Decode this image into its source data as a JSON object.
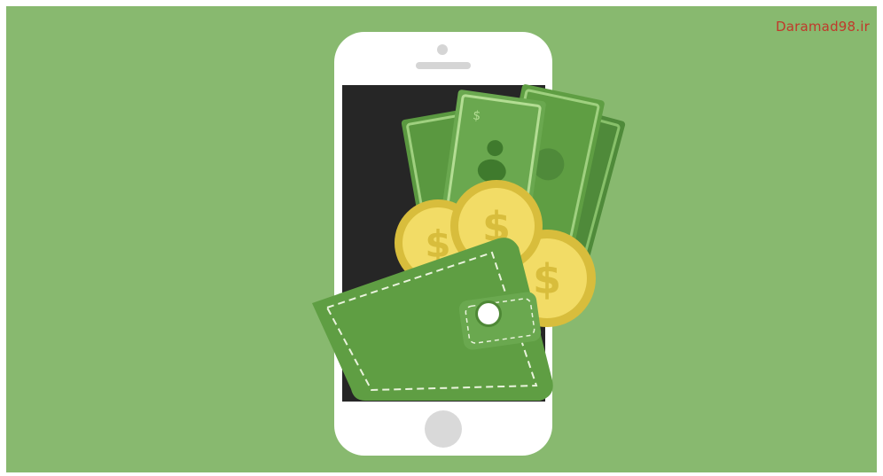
{
  "watermark": {
    "text": "Daramad98.ir"
  },
  "colors": {
    "background": "#88b96f",
    "phone_body": "#ffffff",
    "phone_screen": "#262626",
    "bill": "#6aa84f",
    "bill_dark": "#4f8a3a",
    "coin": "#f2dc66",
    "coin_dark": "#d8bd3c",
    "wallet": "#5f9e43",
    "wallet_dark": "#4e8836",
    "stitch": "#e9f3dc"
  },
  "icons": [
    "phone-illustration",
    "banknote-icon",
    "dollar-coin-icon",
    "wallet-icon"
  ]
}
